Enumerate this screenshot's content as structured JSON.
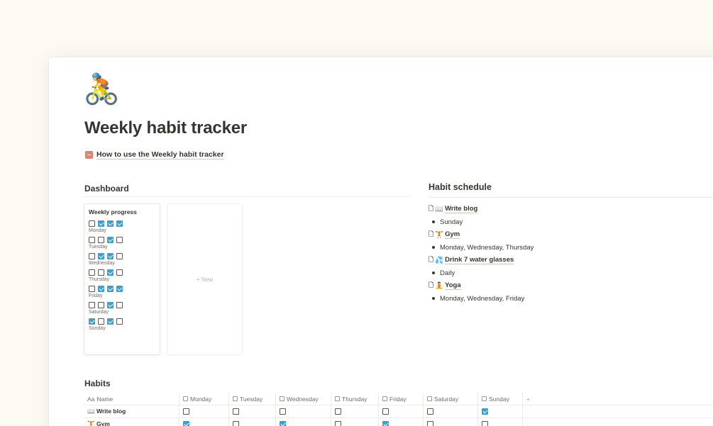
{
  "page": {
    "icon": "🚴",
    "title": "Weekly habit tracker",
    "howto_link": "How to use the Weekly habit tracker"
  },
  "dashboard": {
    "heading": "Dashboard",
    "board_title": "Weekly progress",
    "new_label": "+ New",
    "days": [
      {
        "label": "Monday",
        "checks": [
          false,
          true,
          true,
          true
        ]
      },
      {
        "label": "Tuesday",
        "checks": [
          false,
          false,
          true,
          false
        ]
      },
      {
        "label": "Wednesday",
        "checks": [
          false,
          true,
          true,
          false
        ]
      },
      {
        "label": "Thursday",
        "checks": [
          false,
          false,
          true,
          false
        ]
      },
      {
        "label": "Friday",
        "checks": [
          false,
          true,
          true,
          true
        ]
      },
      {
        "label": "Saturday",
        "checks": [
          false,
          false,
          true,
          false
        ]
      },
      {
        "label": "Sunday",
        "checks": [
          true,
          false,
          true,
          false
        ]
      }
    ]
  },
  "schedule": {
    "heading": "Habit schedule",
    "items": [
      {
        "emoji": "📖",
        "name": "Write blog",
        "days": "Sunday"
      },
      {
        "emoji": "🏋",
        "name": "Gym",
        "days": "Monday, Wednesday, Thursday"
      },
      {
        "emoji": "💦",
        "name": "Drink 7 water glasses",
        "days": "Daily"
      },
      {
        "emoji": "🧘",
        "name": "Yoga",
        "days": "Monday, Wednesday, Friday"
      }
    ]
  },
  "habits": {
    "heading": "Habits",
    "columns": [
      "Name",
      "Monday",
      "Tuesday",
      "Wednesday",
      "Thursday",
      "Friday",
      "Saturday",
      "Sunday"
    ],
    "add_label": "+",
    "rows": [
      {
        "name": "📖 Write blog",
        "checks": [
          false,
          false,
          false,
          false,
          false,
          false,
          true
        ]
      },
      {
        "name": "🏋 Gym",
        "checks": [
          true,
          false,
          true,
          false,
          true,
          false,
          false
        ]
      }
    ]
  },
  "colors": {
    "accent": "#3d9fd0",
    "background": "#fdf9f3"
  }
}
